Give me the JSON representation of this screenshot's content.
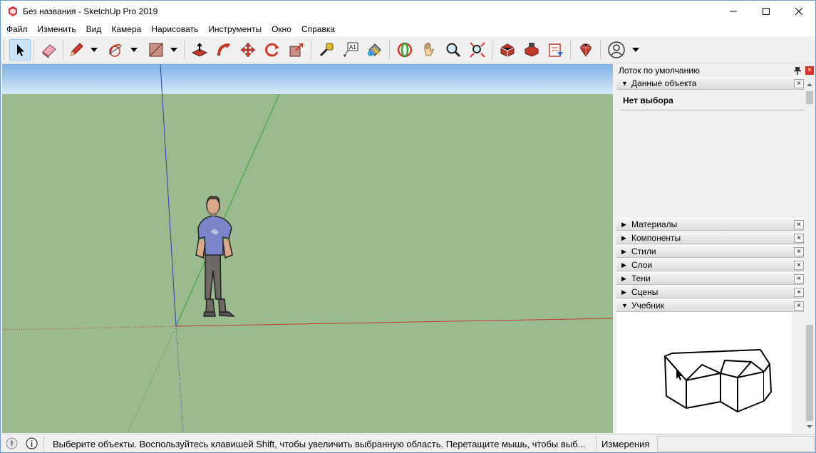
{
  "window": {
    "title": "Без названия - SketchUp Pro 2019"
  },
  "menu": [
    "Файл",
    "Изменить",
    "Вид",
    "Камера",
    "Нарисовать",
    "Инструменты",
    "Окно",
    "Справка"
  ],
  "toolbar": {
    "tools": [
      "select-icon",
      "eraser-icon",
      "pencil-icon",
      "arc-icon",
      "rectangle-icon",
      "push-pull-icon",
      "follow-me-icon",
      "move-icon",
      "rotate-icon",
      "scale-icon",
      "tape-measure-icon",
      "text-icon",
      "paint-bucket-icon",
      "orbit-icon",
      "pan-icon",
      "zoom-icon",
      "zoom-extents-icon",
      "warehouse-icon",
      "extension-warehouse-icon",
      "layout-icon",
      "extension-manager-icon",
      "account-icon"
    ],
    "text_tool_label": "A1"
  },
  "tray": {
    "title": "Лоток по умолчанию",
    "close": "×",
    "entity_info": {
      "header": "Данные объекта",
      "value": "Нет выбора"
    },
    "panels": [
      "Материалы",
      "Компоненты",
      "Стили",
      "Слои",
      "Тени",
      "Сцены",
      "Учебник"
    ],
    "panel_close": "×"
  },
  "statusbar": {
    "hint": "Выберите объекты. Воспользуйтесь клавишей Shift, чтобы увеличить выбранную область. Перетащите мышь, чтобы выб...",
    "measurements_label": "Измерения",
    "measurements_value": ""
  },
  "colors": {
    "sky_top": "#7fb3e6",
    "sky_bottom": "#d6e9f8",
    "ground": "#9bbb8f",
    "axis_red": "#c0392b",
    "axis_green": "#2fa52f",
    "axis_blue": "#2b3fb3"
  }
}
